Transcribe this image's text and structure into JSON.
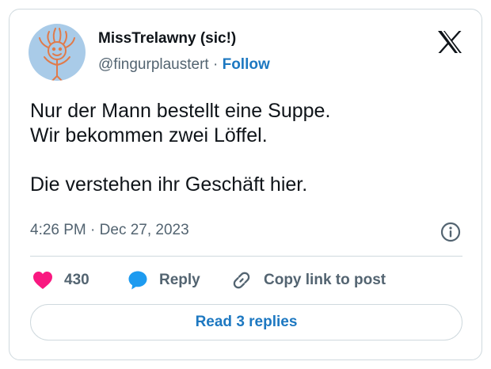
{
  "author": {
    "display_name": "MissTrelawny (sic!)",
    "handle": "@fingurplaustert",
    "separator": "·",
    "follow_label": "Follow"
  },
  "tweet": {
    "text": "Nur der Mann bestellt eine Suppe.\nWir bekommen zwei Löffel.\n\nDie verstehen ihr Geschäft hier.",
    "time": "4:26 PM",
    "separator": "·",
    "date": "Dec 27, 2023"
  },
  "actions": {
    "like_count": "430",
    "reply_label": "Reply",
    "copy_label": "Copy link to post"
  },
  "read_replies_label": "Read 3 replies",
  "colors": {
    "accent_blue": "#1d78c1",
    "like_pink": "#f91880",
    "reply_blue": "#1d9bf0",
    "muted": "#536471",
    "border": "#cfd9de",
    "avatar_bg": "#a9cbe8",
    "avatar_drawing": "#e07a4a"
  },
  "icons": {
    "brand": "x-logo-icon",
    "info": "info-icon",
    "like": "heart-icon",
    "reply": "speech-bubble-icon",
    "copy": "link-icon"
  }
}
